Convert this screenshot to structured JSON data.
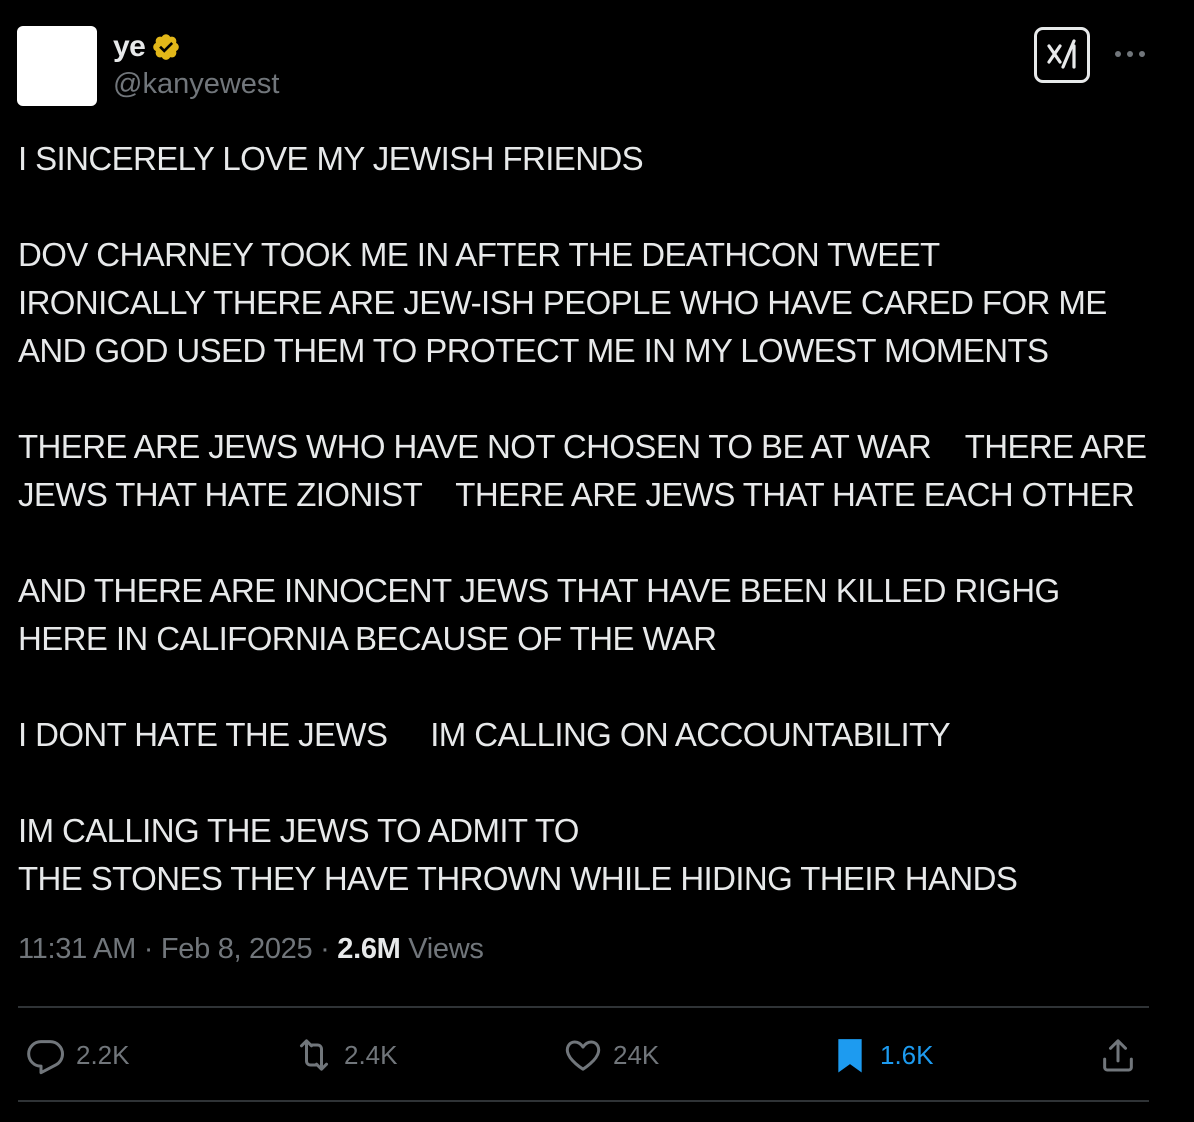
{
  "author": {
    "display_name": "ye",
    "handle": "@kanyewest",
    "verified_badge_color": "#e2b719"
  },
  "icons": {
    "verified": "verified-badge-icon",
    "grok": "grok-icon",
    "more": "more-options-icon",
    "reply": "reply-icon",
    "repost": "repost-icon",
    "like": "heart-icon",
    "bookmark": "bookmark-icon",
    "share": "share-icon"
  },
  "post": {
    "lines": [
      "I SINCERELY LOVE MY JEWISH FRIENDS",
      "",
      "DOV CHARNEY TOOK ME IN AFTER THE DEATHCON TWEET",
      "IRONICALLY THERE ARE JEW-ISH PEOPLE WHO HAVE CARED FOR ME",
      "AND GOD USED THEM TO PROTECT ME IN MY LOWEST MOMENTS",
      "",
      "THERE ARE JEWS WHO HAVE NOT CHOSEN TO BE AT WAR    THERE ARE",
      "JEWS THAT HATE ZIONIST    THERE ARE JEWS THAT HATE EACH OTHER",
      "",
      "AND THERE ARE INNOCENT JEWS THAT HAVE BEEN KILLED RIGHG",
      "HERE IN CALIFORNIA BECAUSE OF THE WAR",
      "",
      "I DONT HATE THE JEWS     IM CALLING ON ACCOUNTABILITY",
      "",
      "IM CALLING THE JEWS TO ADMIT TO",
      "THE STONES THEY HAVE THROWN WHILE HIDING THEIR HANDS"
    ]
  },
  "meta": {
    "time": "11:31 AM",
    "separator": " · ",
    "date": "Feb 8, 2025",
    "views_count": "2.6M",
    "views_label": " Views"
  },
  "actions": {
    "replies": "2.2K",
    "reposts": "2.4K",
    "likes": "24K",
    "bookmarks": "1.6K"
  },
  "colors": {
    "background": "#000000",
    "text": "#e7e9ea",
    "secondary": "#71767b",
    "accent": "#1d9bf0",
    "divider": "#2f3336"
  }
}
